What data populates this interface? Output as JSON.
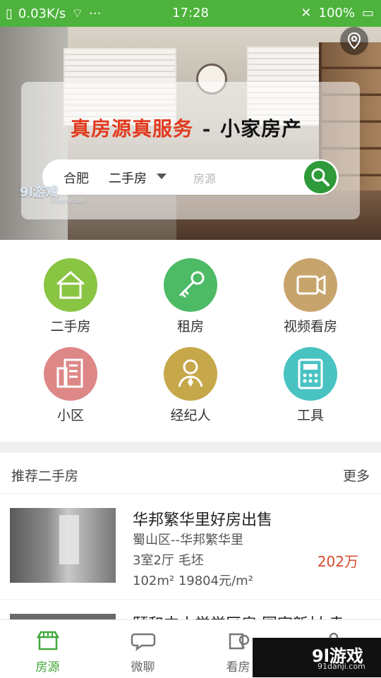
{
  "status_bar": {
    "network_speed": "0.03K/s",
    "time": "17:28",
    "battery": "100%",
    "dots": "···"
  },
  "hero": {
    "headline_red": "真房源真服务",
    "headline_sep": "-",
    "headline_black": "小家房产",
    "city": "合肥",
    "type": "二手房",
    "placeholder": "房源"
  },
  "watermark_top": {
    "brand": "9l游戏",
    "url": "91danji.com"
  },
  "menu": [
    {
      "label": "二手房",
      "icon": "house-icon",
      "color": "#89c442"
    },
    {
      "label": "租房",
      "icon": "key-icon",
      "color": "#4dba65"
    },
    {
      "label": "视频看房",
      "icon": "video-camera-icon",
      "color": "#c8a46d"
    },
    {
      "label": "小区",
      "icon": "building-icon",
      "color": "#de8787"
    },
    {
      "label": "经纪人",
      "icon": "agent-icon",
      "color": "#c6a84a"
    },
    {
      "label": "工具",
      "icon": "calculator-icon",
      "color": "#49c2c2"
    }
  ],
  "recommend": {
    "title": "推荐二手房",
    "more": "更多"
  },
  "listings": [
    {
      "title": "华邦繁华里好房出售",
      "area": "蜀山区--华邦繁华里",
      "rooms": "3室2厅 毛坯",
      "size": "102m² 19804元/m²",
      "price": "202万"
    },
    {
      "title": "颐和中小学学区房 国宾新村 幸"
    }
  ],
  "bottom_nav": [
    {
      "label": "房源",
      "icon": "store-icon",
      "active": true
    },
    {
      "label": "微聊",
      "icon": "chat-bubble-icon",
      "active": false
    },
    {
      "label": "看房",
      "icon": "map-building-icon",
      "active": false
    },
    {
      "label": "",
      "icon": "user-icon",
      "active": false
    }
  ],
  "watermark_corner": {
    "brand": "9l游戏",
    "url": "91danji.com"
  },
  "colors": {
    "status_green": "#4db33c",
    "search_green": "#2e9a3a",
    "price_red": "#d64a2d"
  }
}
